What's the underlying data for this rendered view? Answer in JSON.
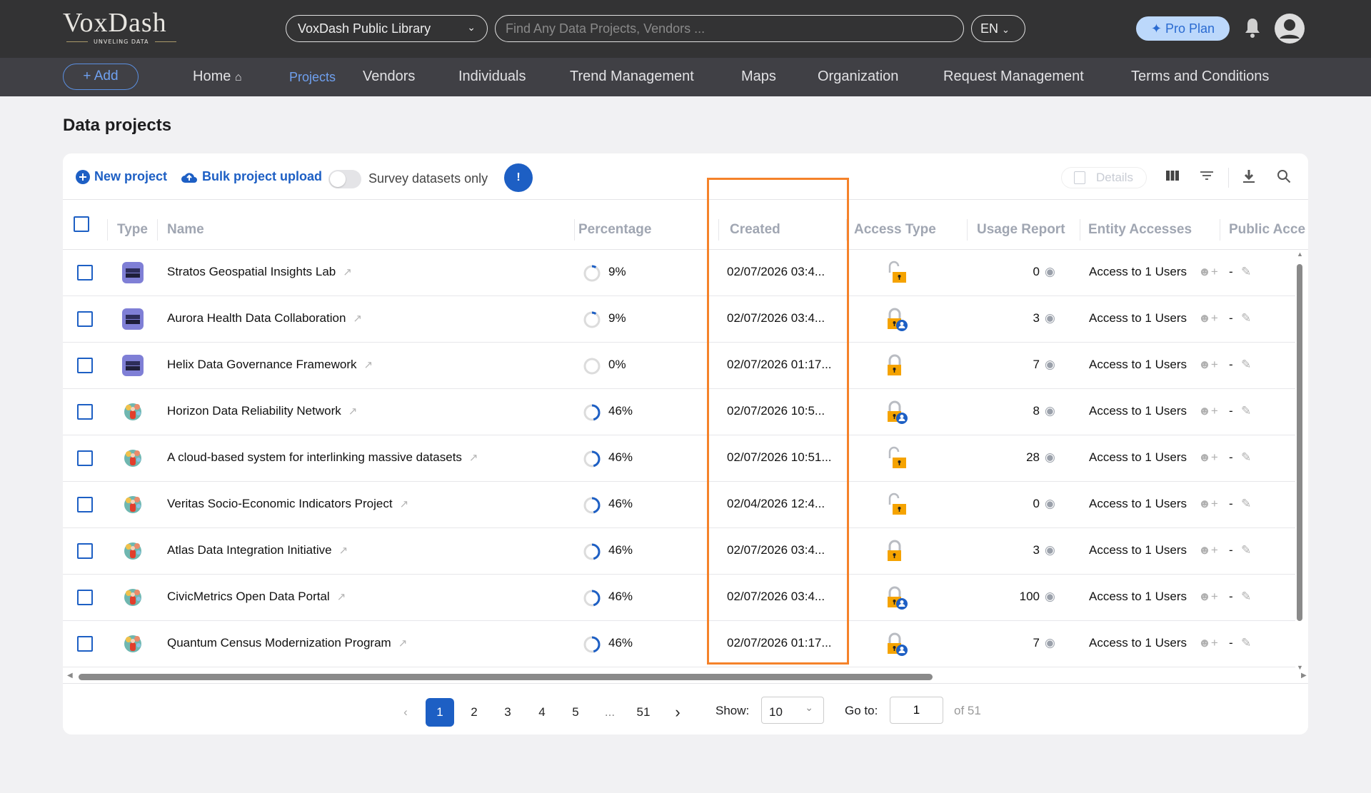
{
  "header": {
    "logo": "VoxDash",
    "logo_tagline": "UNVELING DATA",
    "library_select": "VoxDash Public Library",
    "search_placeholder": "Find Any Data Projects, Vendors ...",
    "language": "EN",
    "pro_plan": "Pro Plan"
  },
  "nav": {
    "add": "Add",
    "items": [
      "Home",
      "Projects",
      "Vendors",
      "Individuals",
      "Trend Management",
      "Maps",
      "Organization",
      "Request Management",
      "Terms and Conditions"
    ],
    "active": "Projects"
  },
  "page": {
    "title": "Data projects"
  },
  "toolbar": {
    "new_project": "New project",
    "bulk_upload": "Bulk project upload",
    "survey_toggle": "Survey datasets only",
    "details": "Details"
  },
  "table": {
    "columns": [
      "Type",
      "Name",
      "Percentage",
      "Created",
      "Access Type",
      "Usage Report",
      "Entity Accesses",
      "Public Acce"
    ],
    "rows": [
      {
        "type": "book",
        "name": "Stratos Geospatial Insights Lab",
        "percentage": "9%",
        "pct": 9,
        "created": "02/07/2026 03:4...",
        "access": "unlocked",
        "usage": "0",
        "entity": "Access to 1 Users",
        "public": "-"
      },
      {
        "type": "book",
        "name": "Aurora Health Data Collaboration",
        "percentage": "9%",
        "pct": 9,
        "created": "02/07/2026 03:4...",
        "access": "locked-user",
        "usage": "3",
        "entity": "Access to 1 Users",
        "public": "-"
      },
      {
        "type": "book",
        "name": "Helix Data Governance Framework",
        "percentage": "0%",
        "pct": 0,
        "created": "02/07/2026 01:17...",
        "access": "locked",
        "usage": "7",
        "entity": "Access to 1 Users",
        "public": "-"
      },
      {
        "type": "globe",
        "name": "Horizon Data Reliability Network",
        "percentage": "46%",
        "pct": 46,
        "created": "02/07/2026 10:5...",
        "access": "locked-user",
        "usage": "8",
        "entity": "Access to 1 Users",
        "public": "-"
      },
      {
        "type": "globe",
        "name": "A cloud-based system for interlinking massive datasets",
        "percentage": "46%",
        "pct": 46,
        "created": "02/07/2026 10:51...",
        "access": "unlocked",
        "usage": "28",
        "entity": "Access to 1 Users",
        "public": "-"
      },
      {
        "type": "globe",
        "name": "Veritas Socio-Economic Indicators Project",
        "percentage": "46%",
        "pct": 46,
        "created": "02/04/2026 12:4...",
        "access": "unlocked",
        "usage": "0",
        "entity": "Access to 1 Users",
        "public": "-"
      },
      {
        "type": "globe",
        "name": "Atlas Data Integration Initiative",
        "percentage": "46%",
        "pct": 46,
        "created": "02/07/2026 03:4...",
        "access": "locked",
        "usage": "3",
        "entity": "Access to 1 Users",
        "public": "-"
      },
      {
        "type": "globe",
        "name": "CivicMetrics Open Data Portal",
        "percentage": "46%",
        "pct": 46,
        "created": "02/07/2026 03:4...",
        "access": "locked-user",
        "usage": "100",
        "entity": "Access to 1 Users",
        "public": "-"
      },
      {
        "type": "globe",
        "name": "Quantum Census Modernization Program",
        "percentage": "46%",
        "pct": 46,
        "created": "02/07/2026 01:17...",
        "access": "locked-user",
        "usage": "7",
        "entity": "Access to 1 Users",
        "public": "-"
      }
    ]
  },
  "pagination": {
    "pages": [
      "1",
      "2",
      "3",
      "4",
      "5",
      "...",
      "51"
    ],
    "current": "1",
    "show_label": "Show:",
    "page_size": "10",
    "goto_label": "Go to:",
    "goto_value": "1",
    "of_total": "of 51"
  },
  "colors": {
    "accent": "#1d5fc4",
    "highlight": "#f5822a",
    "lock": "#f5a300"
  }
}
